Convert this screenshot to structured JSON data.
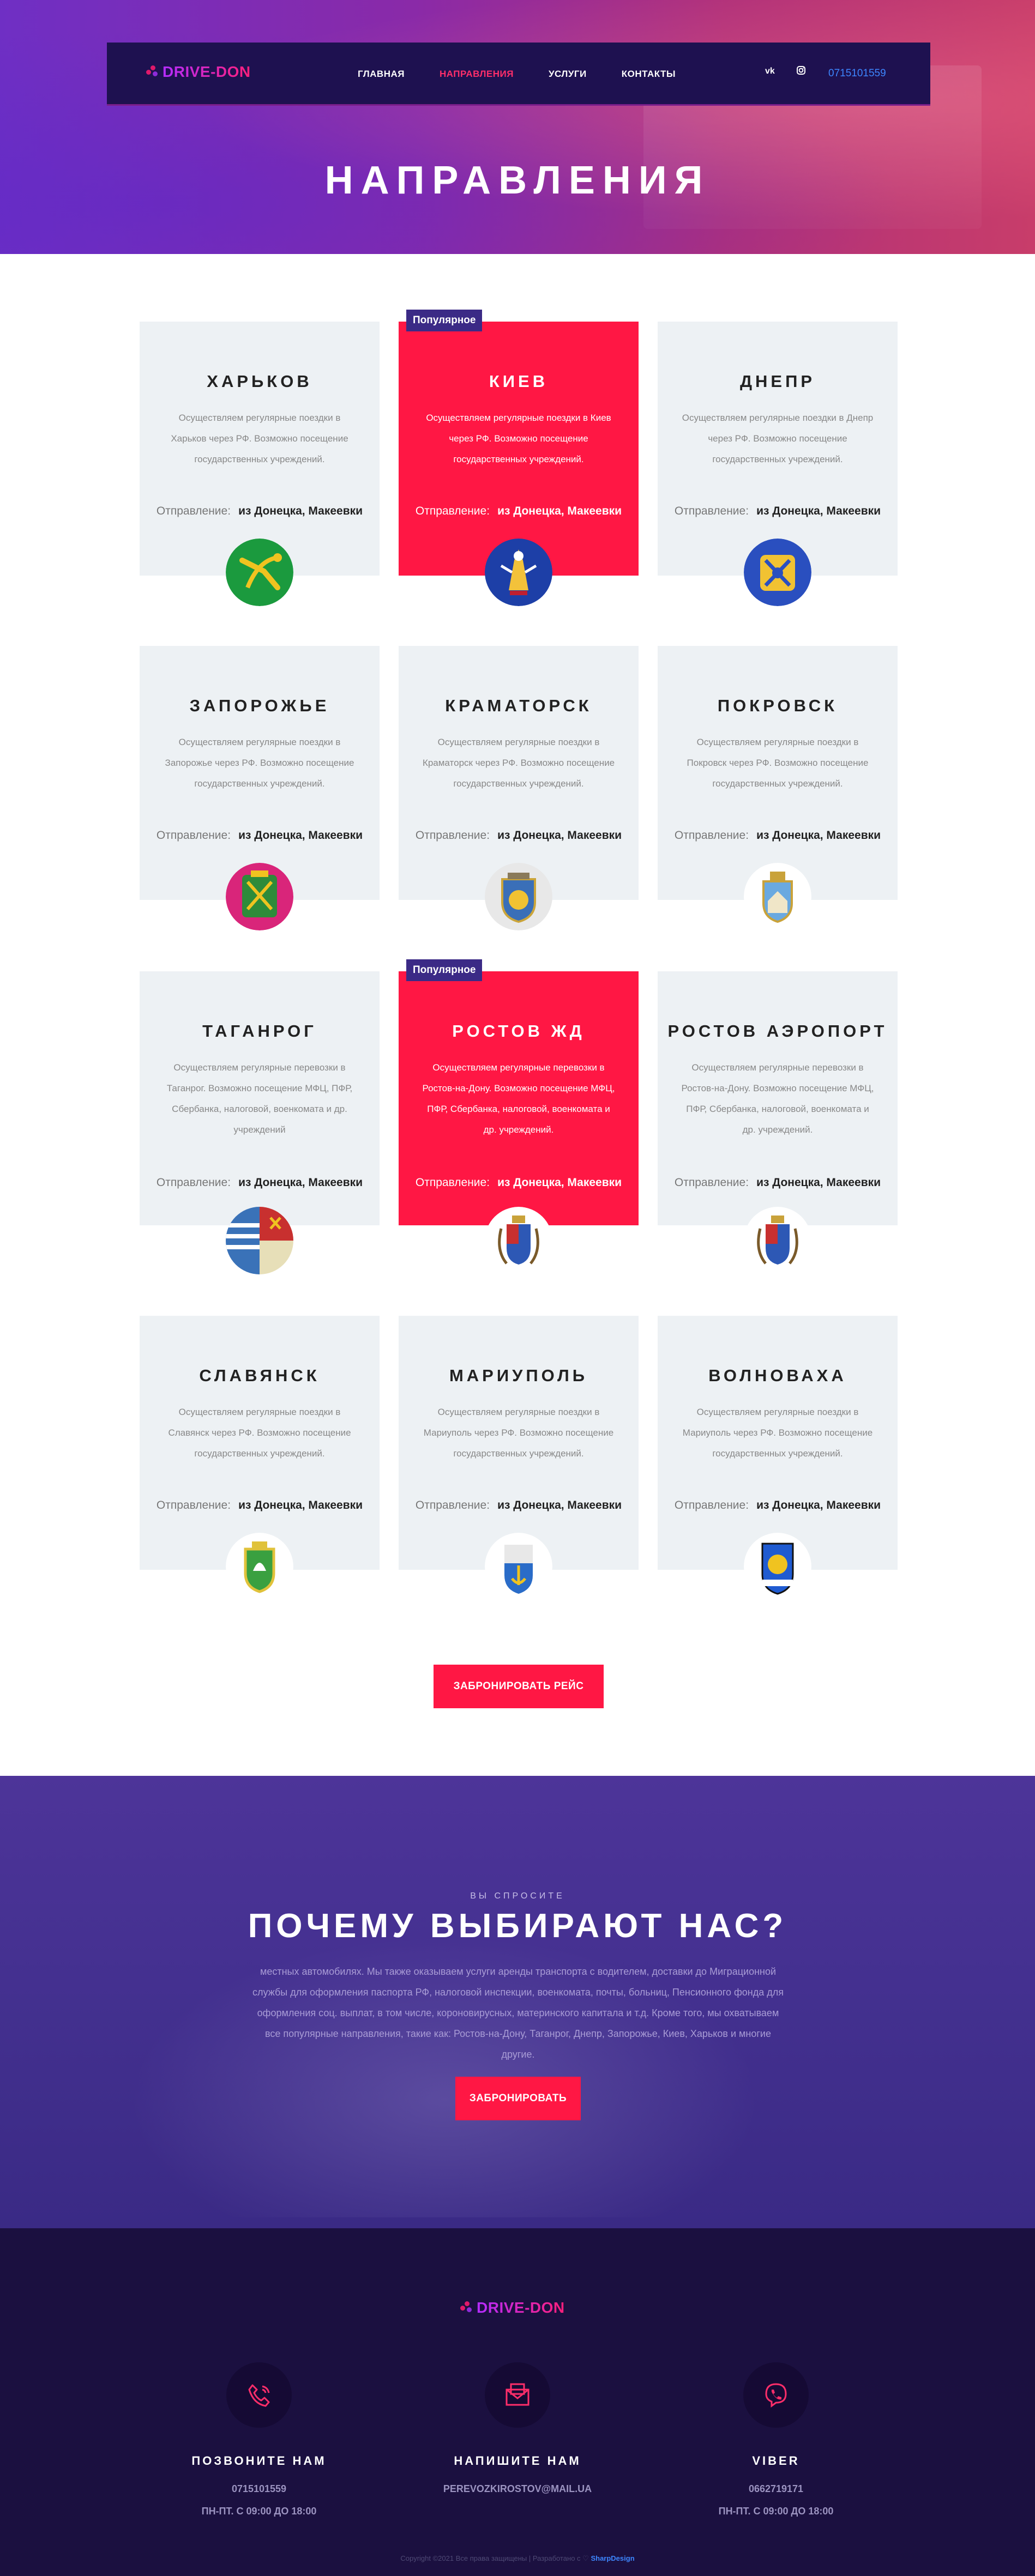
{
  "brand": {
    "logo_text": "DRIVE-DON"
  },
  "nav": {
    "items": [
      {
        "label": "ГЛАВНАЯ",
        "active": false
      },
      {
        "label": "НАПРАВЛЕНИЯ",
        "active": true
      },
      {
        "label": "УСЛУГИ",
        "active": false
      },
      {
        "label": "КОНТАКТЫ",
        "active": false
      }
    ],
    "vk_label": "vk",
    "instagram_icon": "instagram-icon",
    "phone": "0715101559"
  },
  "hero": {
    "title": "НАПРАВЛЕНИЯ"
  },
  "directions": [
    {
      "city": "ХАРЬКОВ",
      "desc": "Осуществляем регулярные поездки в Харьков через РФ. Возможно посещение государственных учреждений.",
      "dep_label": "Отправление:",
      "dep_value": "из Донецка, Макеевки",
      "popular": false
    },
    {
      "city": "КИЕВ",
      "desc": "Осуществляем регулярные поездки в Киев через РФ. Возможно посещение государственных учреждений.",
      "dep_label": "Отправление:",
      "dep_value": "из Донецка, Макеевки",
      "popular": true,
      "badge": "Популярное"
    },
    {
      "city": "ДНЕПР",
      "desc": "Осуществляем регулярные поездки в Днепр через РФ. Возможно посещение государственных учреждений.",
      "dep_label": "Отправление:",
      "dep_value": "из Донецка, Макеевки",
      "popular": false
    },
    {
      "city": "ЗАПОРОЖЬЕ",
      "desc": "Осуществляем регулярные поездки в Запорожье через РФ. Возможно посещение государственных учреждений.",
      "dep_label": "Отправление:",
      "dep_value": "из Донецка, Макеевки",
      "popular": false
    },
    {
      "city": "КРАМАТОРСК",
      "desc": "Осуществляем регулярные поездки в Краматорск через РФ. Возможно посещение государственных учреждений.",
      "dep_label": "Отправление:",
      "dep_value": "из Донецка, Макеевки",
      "popular": false
    },
    {
      "city": "ПОКРОВСК",
      "desc": "Осуществляем регулярные поездки в Покровск через РФ. Возможно посещение государственных учреждений.",
      "dep_label": "Отправление:",
      "dep_value": "из Донецка, Макеевки",
      "popular": false
    },
    {
      "city": "ТАГАНРОГ",
      "desc": "Осуществляем регулярные перевозки в Таганрог. Возможно посещение МФЦ, ПФР, Сбербанка, налоговой, военкомата и др. учреждений",
      "dep_label": "Отправление:",
      "dep_value": "из Донецка, Макеевки",
      "popular": false
    },
    {
      "city": "РОСТОВ ЖД",
      "desc": "Осуществляем регулярные перевозки в Ростов-на-Дону. Возможно посещение МФЦ, ПФР, Сбербанка, налоговой, военкомата и др. учреждений.",
      "dep_label": "Отправление:",
      "dep_value": "из Донецка, Макеевки",
      "popular": true,
      "badge": "Популярное"
    },
    {
      "city": "РОСТОВ АЭРОПОРТ",
      "desc": "Осуществляем регулярные перевозки в Ростов-на-Дону. Возможно посещение МФЦ, ПФР, Сбербанка, налоговой, военкомата и др. учреждений.",
      "dep_label": "Отправление:",
      "dep_value": "из Донецка, Макеевки",
      "popular": false
    },
    {
      "city": "СЛАВЯНСК",
      "desc": "Осуществляем регулярные поездки в Славянск через РФ. Возможно посещение государственных учреждений.",
      "dep_label": "Отправление:",
      "dep_value": "из Донецка, Макеевки",
      "popular": false
    },
    {
      "city": "МАРИУПОЛЬ",
      "desc": "Осуществляем регулярные поездки в Мариуполь через РФ. Возможно посещение государственных учреждений.",
      "dep_label": "Отправление:",
      "dep_value": "из Донецка, Макеевки",
      "popular": false
    },
    {
      "city": "ВОЛНОВАХА",
      "desc": "Осуществляем регулярные поездки в Мариуполь через РФ. Возможно посещение государственных учреждений.",
      "dep_label": "Отправление:",
      "dep_value": "из Донецка, Макеевки",
      "popular": false
    }
  ],
  "book_route_button": "ЗАБРОНИРОВАТЬ РЕЙС",
  "why": {
    "kicker": "ВЫ СПРОСИТЕ",
    "title": "ПОЧЕМУ ВЫБИРАЮТ НАС?",
    "text": "местных автомобилях. Мы также оказываем услуги аренды транспорта с водителем, доставки до Миграционной службы для оформления паспорта РФ, налоговой инспекции, военкомата, почты, больниц, Пенсионного фонда для оформления соц. выплат, в том числе, короновирусных, материнского капитала и т.д. Кроме того, мы охватываем все популярные направления, такие как: Ростов-на-Дону, Таганрог, Днепр, Запорожье, Киев, Харьков и многие другие.",
    "button": "ЗАБРОНИРОВАТЬ"
  },
  "footer": {
    "logo_text": "DRIVE-DON",
    "contacts": [
      {
        "icon": "phone-icon",
        "title": "ПОЗВОНИТЕ НАМ",
        "value": "0715101559",
        "hours": "ПН-ПТ. С 09:00 ДО 18:00"
      },
      {
        "icon": "mail-icon",
        "title": "НАПИШИТЕ НАМ",
        "value": "PEREVOZKIROSTOV@MAIL.UA",
        "hours": ""
      },
      {
        "icon": "viber-icon",
        "title": "VIBER",
        "value": "0662719171",
        "hours": "ПН-ПТ. С 09:00 ДО 18:00"
      }
    ],
    "copyright": "Copyright ©2021 Все права защищены | Разработано с ♡",
    "developer": "SharpDesign"
  },
  "colors": {
    "accent": "#ff1744",
    "nav_bg": "#1e1150",
    "badge": "#3b2a86",
    "footer_bg": "#1b1040",
    "link": "#3d86ff"
  }
}
